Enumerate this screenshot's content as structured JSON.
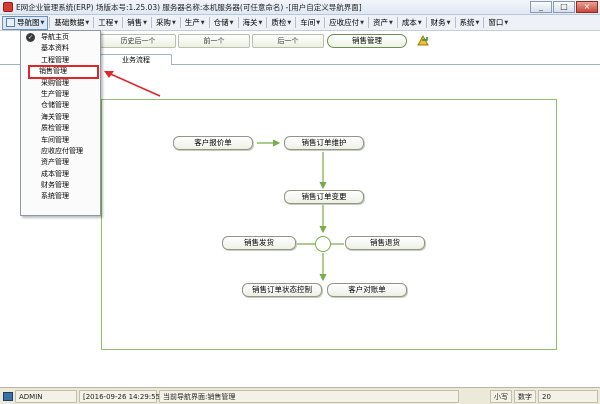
{
  "window": {
    "title": "E网企业管理系统(ERP) 场版本号:1.25.03) 服务器名称:本机服务器(可任意命名) -[用户自定义导航界面]",
    "controls": [
      "_",
      "□",
      "×"
    ]
  },
  "menubar": {
    "items": [
      {
        "label": "导航图",
        "has_arrow": true,
        "active": true
      },
      {
        "label": "基础数据",
        "has_arrow": true
      },
      {
        "label": "工程",
        "has_arrow": true
      },
      {
        "label": "销售",
        "has_arrow": true
      },
      {
        "label": "采购",
        "has_arrow": true
      },
      {
        "label": "生产",
        "has_arrow": true
      },
      {
        "label": "仓储",
        "has_arrow": true
      },
      {
        "label": "海关",
        "has_arrow": true
      },
      {
        "label": "质检",
        "has_arrow": true
      },
      {
        "label": "车间",
        "has_arrow": true
      },
      {
        "label": "应收应付",
        "has_arrow": true
      },
      {
        "label": "资产",
        "has_arrow": true
      },
      {
        "label": "成本",
        "has_arrow": true
      },
      {
        "label": "财务",
        "has_arrow": true
      },
      {
        "label": "系统",
        "has_arrow": true
      },
      {
        "label": "窗口",
        "has_arrow": true
      }
    ]
  },
  "dropdown": {
    "items": [
      {
        "label": "导航主页",
        "checked": true
      },
      {
        "label": "基本资料"
      },
      {
        "label": "工程管理"
      },
      {
        "label": "销售管理",
        "highlighted": true
      },
      {
        "label": "采购管理"
      },
      {
        "label": "生产管理"
      },
      {
        "label": "仓储管理"
      },
      {
        "label": "海关管理"
      },
      {
        "label": "质检管理"
      },
      {
        "label": "车间管理"
      },
      {
        "label": "应收应付管理"
      },
      {
        "label": "资产管理"
      },
      {
        "label": "成本管理"
      },
      {
        "label": "财务管理"
      },
      {
        "label": "系统管理"
      }
    ]
  },
  "nav": {
    "history_back": "历史后一个",
    "prev": "前一个",
    "next": "后一个",
    "current_page": "销售管理"
  },
  "tabs": {
    "flow": "业务流程"
  },
  "flow": {
    "quote": "客户报价单",
    "order_maintain": "销售订单维护",
    "order_change": "销售订单变更",
    "ship": "销售发货",
    "return": "销售退货",
    "status_control": "销售订单状态控制",
    "reconcile": "客户对账单"
  },
  "statusbar": {
    "user": "ADMIN",
    "datetime": "[2016-09-26 14:29:55]",
    "current_page": "当前导航界面:销售管理",
    "caps": "小写",
    "num": "数字",
    "extra": "20"
  },
  "colors": {
    "highlight": "#e0262a",
    "flow_frame": "#8cc26a",
    "arrow": "#76ad4a"
  }
}
